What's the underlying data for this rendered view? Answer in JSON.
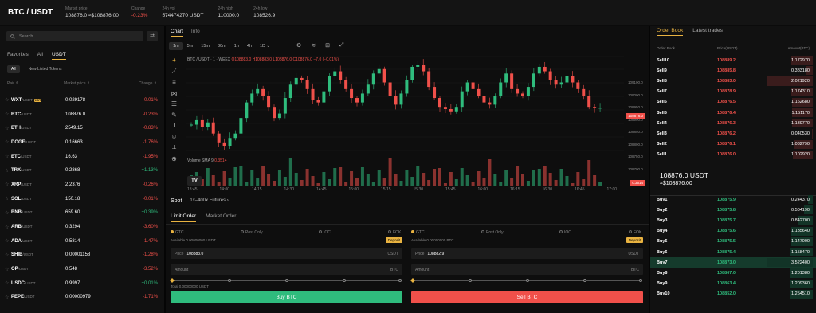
{
  "header": {
    "pair": "BTC / USDT",
    "market_price_label": "Market price",
    "market_price": "108876.0 ≈$108876.00",
    "change_label": "Change",
    "change": "-0.23%",
    "vol_label": "24h vol",
    "vol": "574474270 USDT",
    "high_label": "24h high",
    "high": "110000.0",
    "low_label": "24h low",
    "low": "108526.9"
  },
  "markets": {
    "search_placeholder": "Search",
    "tabs": [
      "Favorites",
      "All",
      "USDT"
    ],
    "subtabs": [
      "All",
      "New Listed Tokens"
    ],
    "col_pair": "Pair ⇕",
    "col_price": "Market price ⇕",
    "col_change": "Change ⇕",
    "hot_label": "HOT",
    "rows": [
      {
        "sym": "WXT",
        "quote": "/USDT",
        "price": "0.029178",
        "chg": "-0.01%",
        "up": false
      },
      {
        "sym": "BTC",
        "quote": "/USDT",
        "price": "108876.0",
        "chg": "-0.23%",
        "up": false
      },
      {
        "sym": "ETH",
        "quote": "/USDT",
        "price": "2549.15",
        "chg": "-0.83%",
        "up": false
      },
      {
        "sym": "DOGE",
        "quote": "/USDT",
        "price": "0.16663",
        "chg": "-1.76%",
        "up": false
      },
      {
        "sym": "ETC",
        "quote": "/USDT",
        "price": "16.63",
        "chg": "-1.95%",
        "up": false
      },
      {
        "sym": "TRX",
        "quote": "/USDT",
        "price": "0.2868",
        "chg": "+1.13%",
        "up": true
      },
      {
        "sym": "XRP",
        "quote": "/USDT",
        "price": "2.2376",
        "chg": "-0.26%",
        "up": false
      },
      {
        "sym": "SOL",
        "quote": "/USDT",
        "price": "150.18",
        "chg": "-0.01%",
        "up": false
      },
      {
        "sym": "BNB",
        "quote": "/USDT",
        "price": "659.60",
        "chg": "+0.39%",
        "up": true
      },
      {
        "sym": "ARB",
        "quote": "/USDT",
        "price": "0.3294",
        "chg": "-3.60%",
        "up": false
      },
      {
        "sym": "ADA",
        "quote": "/USDT",
        "price": "0.5814",
        "chg": "-1.47%",
        "up": false
      },
      {
        "sym": "SHIB",
        "quote": "/USDT",
        "price": "0.00001158",
        "chg": "-1.28%",
        "up": false
      },
      {
        "sym": "OP",
        "quote": "/USDT",
        "price": "0.548",
        "chg": "-3.52%",
        "up": false
      },
      {
        "sym": "USDC",
        "quote": "/USDT",
        "price": "0.9997",
        "chg": "+0.01%",
        "up": true
      },
      {
        "sym": "PEPE",
        "quote": "/USDT",
        "price": "0.00000979",
        "chg": "-1.71%",
        "up": false
      }
    ]
  },
  "chart": {
    "tabs": [
      "Chart",
      "Info"
    ],
    "intervals": [
      "1m",
      "5m",
      "15m",
      "30m",
      "1h",
      "4h",
      "1D ⌄"
    ],
    "legend": "BTC / USDT · 1 · WEEX",
    "ohlc": "O108883.0 H108883.0 L108876.0 C108876.0 −7.0 (−0.01%)",
    "volume_label": "Volume SMA 9",
    "volume_value": "0.3514",
    "price_tag": "108876.0",
    "volume_tag": "0.3514",
    "y_ticks": [
      "109100.0",
      "109000.0",
      "108950.0",
      "108900.0",
      "108850.0",
      "108800.0",
      "108750.0",
      "108700.0"
    ],
    "x_ticks": [
      "13:45",
      "14:00",
      "14:15",
      "14:30",
      "14:45",
      "15:00",
      "15:15",
      "15:30",
      "15:45",
      "16:00",
      "16:15",
      "16:30",
      "16:45",
      "17:00"
    ],
    "tv_logo": "TV",
    "chart_data": {
      "type": "candlestick",
      "close_series": [
        108800,
        108820,
        108790,
        108810,
        108760,
        108720,
        108705,
        108740,
        108760,
        108830,
        108900,
        108940,
        108960,
        108930,
        108880,
        108830,
        108850,
        108920,
        108980,
        109010,
        109000,
        108960,
        108910,
        108900,
        108950,
        109020,
        109040,
        109000,
        108960,
        108920,
        108900,
        108940,
        108980,
        109030,
        109050,
        108990,
        108930,
        108890,
        108940,
        109000,
        109060,
        109070,
        109040,
        108970,
        108920,
        108880,
        108870,
        108860,
        108880,
        108950,
        108990,
        108960,
        108930,
        108900,
        108890,
        108930,
        108990,
        109030,
        108960,
        108940,
        108930,
        108970,
        109030,
        109060,
        109040,
        109000,
        108980,
        108990,
        109020,
        108990,
        108960,
        108930,
        108880,
        108875,
        108876
      ],
      "ylim": [
        108680,
        109110
      ]
    }
  },
  "order": {
    "spot_label": "Spot",
    "futures_label": "1x–400x Futures ›",
    "tabs": [
      "Limit Order",
      "Market Order"
    ],
    "options": [
      "GTC",
      "Post Only",
      "IOC",
      "FOK"
    ],
    "buy": {
      "available": "Available 0.00000000 USDT",
      "deposit": "Deposit",
      "price_label": "Price",
      "price": "108883.0",
      "price_unit": "USDT",
      "amount_label": "Amount",
      "amount_unit": "BTC",
      "total": "Total 0.00000000 USDT",
      "button": "Buy BTC"
    },
    "sell": {
      "available": "Available 0.00000000 BTC",
      "deposit": "Deposit",
      "price_label": "Price",
      "price": "108882.9",
      "price_unit": "USDT",
      "amount_label": "Amount",
      "amount_unit": "BTC",
      "button": "Sell BTC"
    }
  },
  "book": {
    "tabs": [
      "Order Book",
      "Latest trades"
    ],
    "col_book": "Order Book",
    "col_price": "Price(USDT)",
    "col_amount": "Amount(BTC)",
    "sells": [
      {
        "n": "Sell10",
        "p": "108889.2",
        "a": "1.172970",
        "d": 0.45
      },
      {
        "n": "Sell9",
        "p": "108885.8",
        "a": "0.383180",
        "d": 0.14
      },
      {
        "n": "Sell8",
        "p": "108883.0",
        "a": "2.021920",
        "d": 0.95
      },
      {
        "n": "Sell7",
        "p": "108878.9",
        "a": "1.174310",
        "d": 0.45
      },
      {
        "n": "Sell6",
        "p": "108876.5",
        "a": "1.162680",
        "d": 0.44
      },
      {
        "n": "Sell5",
        "p": "108876.4",
        "a": "1.151170",
        "d": 0.44
      },
      {
        "n": "Sell4",
        "p": "108876.3",
        "a": "1.139770",
        "d": 0.43
      },
      {
        "n": "Sell3",
        "p": "108876.2",
        "a": "0.040530",
        "d": 0.02
      },
      {
        "n": "Sell2",
        "p": "108876.1",
        "a": "1.032790",
        "d": 0.4
      },
      {
        "n": "Sell1",
        "p": "108876.0",
        "a": "1.102920",
        "d": 0.42
      }
    ],
    "last_price": "108876.0 USDT",
    "last_usd": "≈$108876.00",
    "buys": [
      {
        "n": "Buy1",
        "p": "108875.9",
        "a": "0.244370",
        "d": 0.1
      },
      {
        "n": "Buy2",
        "p": "108875.8",
        "a": "0.504190",
        "d": 0.19
      },
      {
        "n": "Buy3",
        "p": "108875.7",
        "a": "0.842700",
        "d": 0.32
      },
      {
        "n": "Buy4",
        "p": "108875.6",
        "a": "1.135640",
        "d": 0.45
      },
      {
        "n": "Buy5",
        "p": "108875.5",
        "a": "1.147000",
        "d": 0.45
      },
      {
        "n": "Buy6",
        "p": "108875.4",
        "a": "1.158470",
        "d": 0.46
      },
      {
        "n": "Buy7",
        "p": "108873.0",
        "a": "3.522400",
        "d": 0.96
      },
      {
        "n": "Buy8",
        "p": "108867.0",
        "a": "1.201380",
        "d": 0.47
      },
      {
        "n": "Buy9",
        "p": "108863.4",
        "a": "1.209360",
        "d": 0.48
      },
      {
        "n": "Buy10",
        "p": "108852.0",
        "a": "1.254510",
        "d": 0.49
      }
    ]
  },
  "colors": {
    "up": "#2fbc7d",
    "down": "#f0504a",
    "accent": "#e9b341"
  }
}
